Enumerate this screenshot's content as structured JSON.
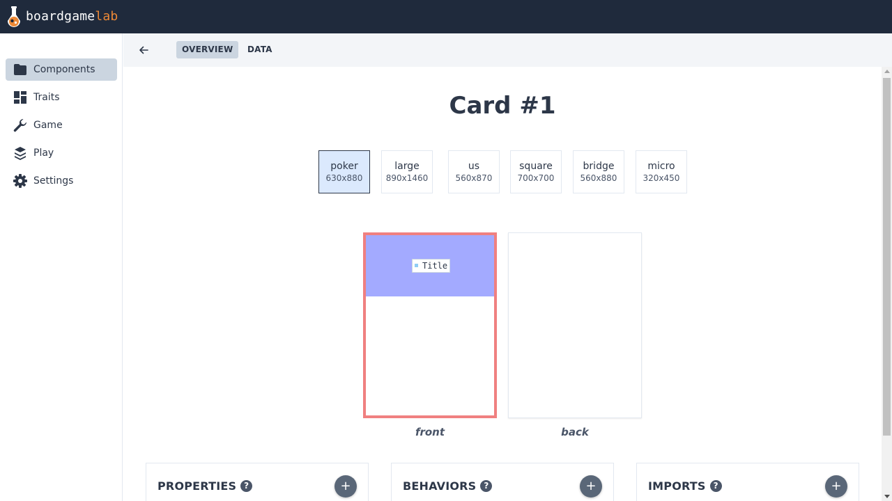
{
  "app": {
    "logo_text_main": "boardgame",
    "logo_text_accent": "lab",
    "accent_color": "#ed8936",
    "topbar_color": "#1f2a3c"
  },
  "sidebar": {
    "items": [
      {
        "label": "Components",
        "icon": "folder-icon",
        "active": true
      },
      {
        "label": "Traits",
        "icon": "dashboard-icon",
        "active": false
      },
      {
        "label": "Game",
        "icon": "wrench-icon",
        "active": false
      },
      {
        "label": "Play",
        "icon": "stack-icon",
        "active": false
      },
      {
        "label": "Settings",
        "icon": "gear-icon",
        "active": false
      }
    ]
  },
  "subheader": {
    "back_icon": "arrow-left-icon",
    "tabs": [
      {
        "label": "OVERVIEW",
        "active": true
      },
      {
        "label": "DATA",
        "active": false
      }
    ]
  },
  "main": {
    "title": "Card #1",
    "sizes": [
      {
        "name": "poker",
        "dims": "630x880",
        "selected": true
      },
      {
        "name": "large",
        "dims": "890x1460",
        "selected": false
      },
      {
        "name": "us",
        "dims": "560x870",
        "selected": false
      },
      {
        "name": "square",
        "dims": "700x700",
        "selected": false
      },
      {
        "name": "bridge",
        "dims": "560x880",
        "selected": false
      },
      {
        "name": "micro",
        "dims": "320x450",
        "selected": false
      }
    ],
    "front": {
      "label": "front",
      "title_chip": "Title",
      "border_color": "#f08080",
      "band_color": "#a3aaff"
    },
    "back": {
      "label": "back"
    },
    "panels": [
      {
        "title": "PROPERTIES",
        "help": "?",
        "add": "+"
      },
      {
        "title": "BEHAVIORS",
        "help": "?",
        "add": "+"
      },
      {
        "title": "IMPORTS",
        "help": "?",
        "add": "+"
      }
    ]
  }
}
